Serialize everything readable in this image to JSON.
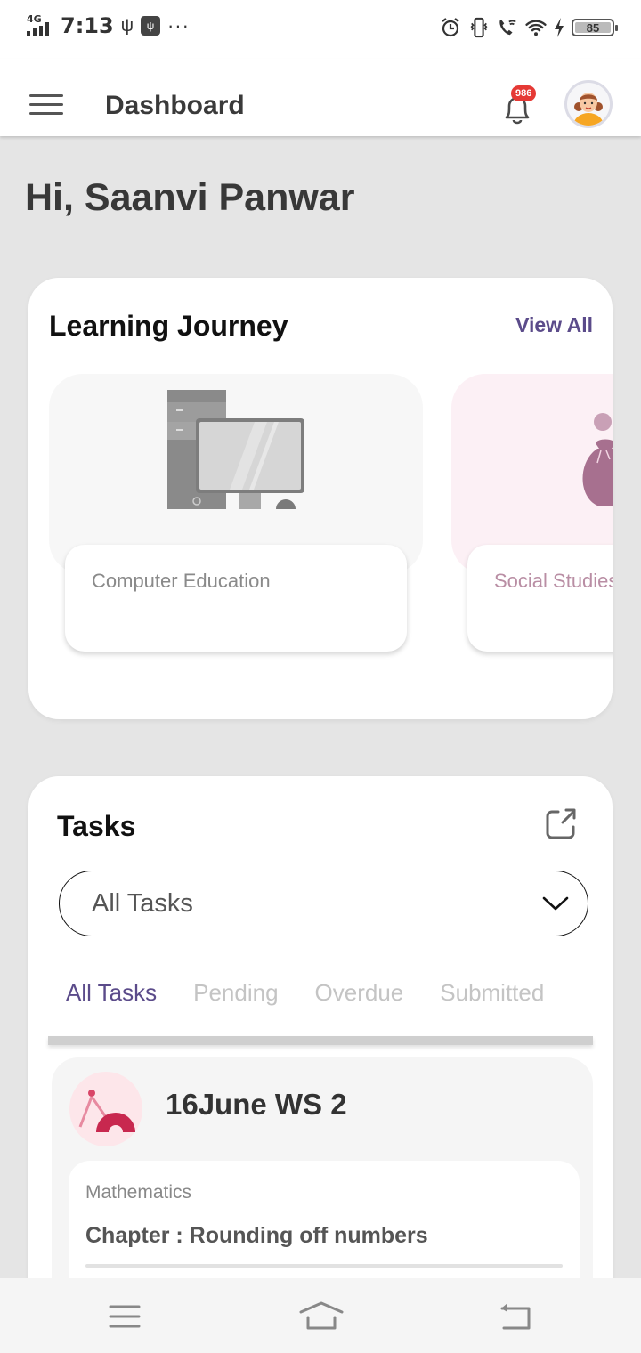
{
  "status_bar": {
    "network": "4G",
    "time": "7:13",
    "battery": "85",
    "icons": [
      "signal-icon",
      "usb-icon",
      "usb-settings-icon",
      "more-dots-icon",
      "alarm-icon",
      "vibrate-icon",
      "wifi-calling-icon",
      "wifi-icon",
      "charging-icon",
      "battery-icon"
    ]
  },
  "app_bar": {
    "title": "Dashboard",
    "notification_count": "986"
  },
  "greeting": "Hi, Saanvi Panwar",
  "learning_journey": {
    "title": "Learning Journey",
    "view_all_label": "View All",
    "courses": [
      {
        "label": "Computer Education",
        "icon": "computer-icon",
        "bg_color": "#f7f7f7",
        "text_color": "#8a8a8a"
      },
      {
        "label": "Social Studies",
        "icon": "money-bag-icon",
        "bg_color": "#fcf0f5",
        "text_color": "#b98ea4"
      }
    ]
  },
  "tasks": {
    "title": "Tasks",
    "filter_value": "All Tasks",
    "tabs": [
      {
        "label": "All Tasks",
        "active": true
      },
      {
        "label": "Pending",
        "active": false
      },
      {
        "label": "Overdue",
        "active": false
      },
      {
        "label": "Submitted",
        "active": false
      }
    ],
    "items": [
      {
        "name": "16June WS 2",
        "subject": "Mathematics",
        "chapter": "Chapter : Rounding off numbers",
        "icon": "geometry-tools-icon"
      }
    ]
  },
  "colors": {
    "accent": "#5b4b8a",
    "badge": "#e53935",
    "background": "#e5e5e5"
  }
}
